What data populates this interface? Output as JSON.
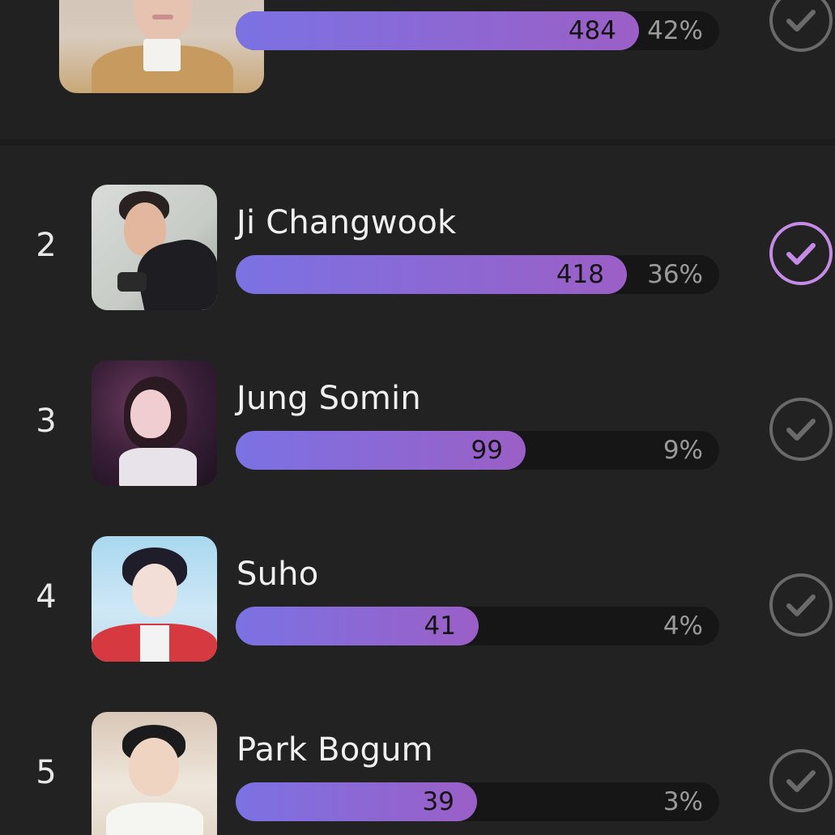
{
  "colors": {
    "background": "#222223",
    "bar_track": "#161617",
    "bar_fill_start": "#7b72e3",
    "bar_fill_end": "#9b5fc6",
    "check_selected": "#c58be6",
    "check_unselected": "#6a6a6a"
  },
  "top_entry": {
    "count": "484",
    "percent": "42%",
    "progress": 0.42,
    "check_icon": "check-circle-icon"
  },
  "entries": [
    {
      "rank": "2",
      "name": "Ji Changwook",
      "count": "418",
      "percent": "36%",
      "progress": 0.36,
      "selected": true
    },
    {
      "rank": "3",
      "name": "Jung Somin",
      "count": "99",
      "percent": "9%",
      "progress": 0.09,
      "selected": false
    },
    {
      "rank": "4",
      "name": "Suho",
      "count": "41",
      "percent": "4%",
      "progress": 0.04,
      "selected": false
    },
    {
      "rank": "5",
      "name": "Park Bogum",
      "count": "39",
      "percent": "3%",
      "progress": 0.03,
      "selected": false
    }
  ]
}
